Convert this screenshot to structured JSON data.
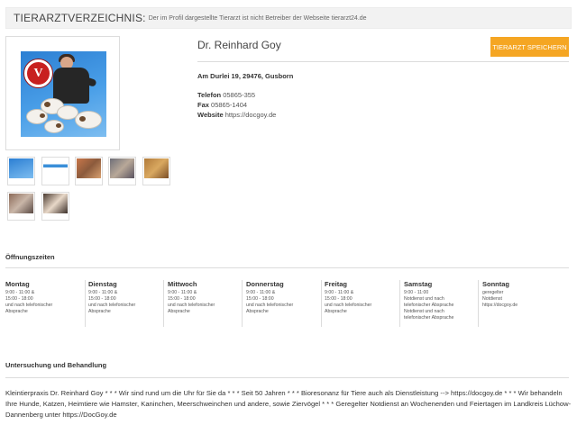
{
  "banner": {
    "title": "TIERARZTVERZEICHNIS:",
    "text": "Der im Profil dargestellte Tierarzt ist nicht Betreiber der Webseite tierarzt24.de"
  },
  "profile": {
    "name": "Dr. Reinhard Goy",
    "save_button": "TIERARZT SPEICHERN",
    "address": "Am Durlei 19, 29476, Gusborn",
    "phone_label": "Telefon",
    "phone": "05865-355",
    "fax_label": "Fax",
    "fax": "05865-1404",
    "website_label": "Website",
    "website": "https://docgoy.de"
  },
  "opening_hours": {
    "title": "Öffnungszeiten",
    "days": [
      {
        "name": "Montag",
        "text": "9:00 - 11:00 &\n15:00 - 18:00\nund nach telefonischer\nAbsprache"
      },
      {
        "name": "Dienstag",
        "text": "9:00 - 11:00 &\n15:00 - 18:00\nund nach telefonischer\nAbsprache"
      },
      {
        "name": "Mittwoch",
        "text": "9:00 - 11:00 &\n15:00 - 18:00\nund nach telefonischer\nAbsprache"
      },
      {
        "name": "Donnerstag",
        "text": "9:00 - 11:00 &\n15:00 - 18:00\nund nach telefonischer\nAbsprache"
      },
      {
        "name": "Freitag",
        "text": "9:00 - 11:00 &\n15:00 - 18:00\nund nach telefonischer\nAbsprache"
      },
      {
        "name": "Samstag",
        "text": "9:00 - 11:00\nNotdienst und nach\ntelefonischer Absprache\nNotdienst und nach\ntelefonischer Absprache"
      },
      {
        "name": "Sonntag",
        "text": "geregelter\nNotdienst\nhttps://docgoy.de"
      }
    ]
  },
  "treatment": {
    "title": "Untersuchung und Behandlung",
    "description": "Kleintierpraxis Dr. Reinhard Goy * * * Wir sind rund um die Uhr für Sie da * * * Seit 50 Jahren * * * Bioresonanz für Tiere auch als Dienstleistung --> https://docgoy.de * * * Wir behandeln Ihre Hunde, Katzen, Heimtiere wie Hamster, Kaninchen, Meerschweinchen und andere, sowie Ziervögel * * * Geregelter Notdienst an Wochenenden und Feiertagen im Landkreis Lüchow-Dannenberg unter https://DocGoy.de"
  },
  "colors": {
    "accent": "#f5a623",
    "logo_red": "#c8201f",
    "photo_blue": "#2c7fd3"
  },
  "icons": {
    "logo": "vet-logo-icon"
  }
}
